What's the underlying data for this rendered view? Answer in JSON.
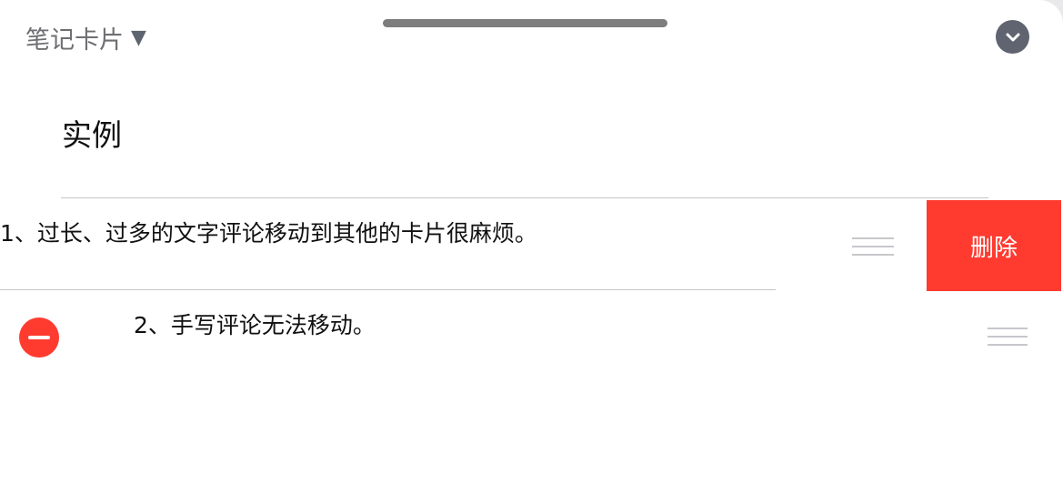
{
  "header": {
    "title": "笔记卡片",
    "caret": "▼",
    "collapse_icon": "chevron-down-icon"
  },
  "card": {
    "title": "实例"
  },
  "items": [
    {
      "text": "1、过长、过多的文字评论移动到其他的卡片很麻烦。",
      "state": "swiped"
    },
    {
      "text": "2、手写评论无法移动。",
      "state": "editing"
    }
  ],
  "actions": {
    "delete_label": "删除"
  },
  "colors": {
    "accent_red": "#ff3b30",
    "grabber": "#7d7d7d",
    "collapse_button": "#5f6470",
    "title_gray": "#6e6e73"
  }
}
